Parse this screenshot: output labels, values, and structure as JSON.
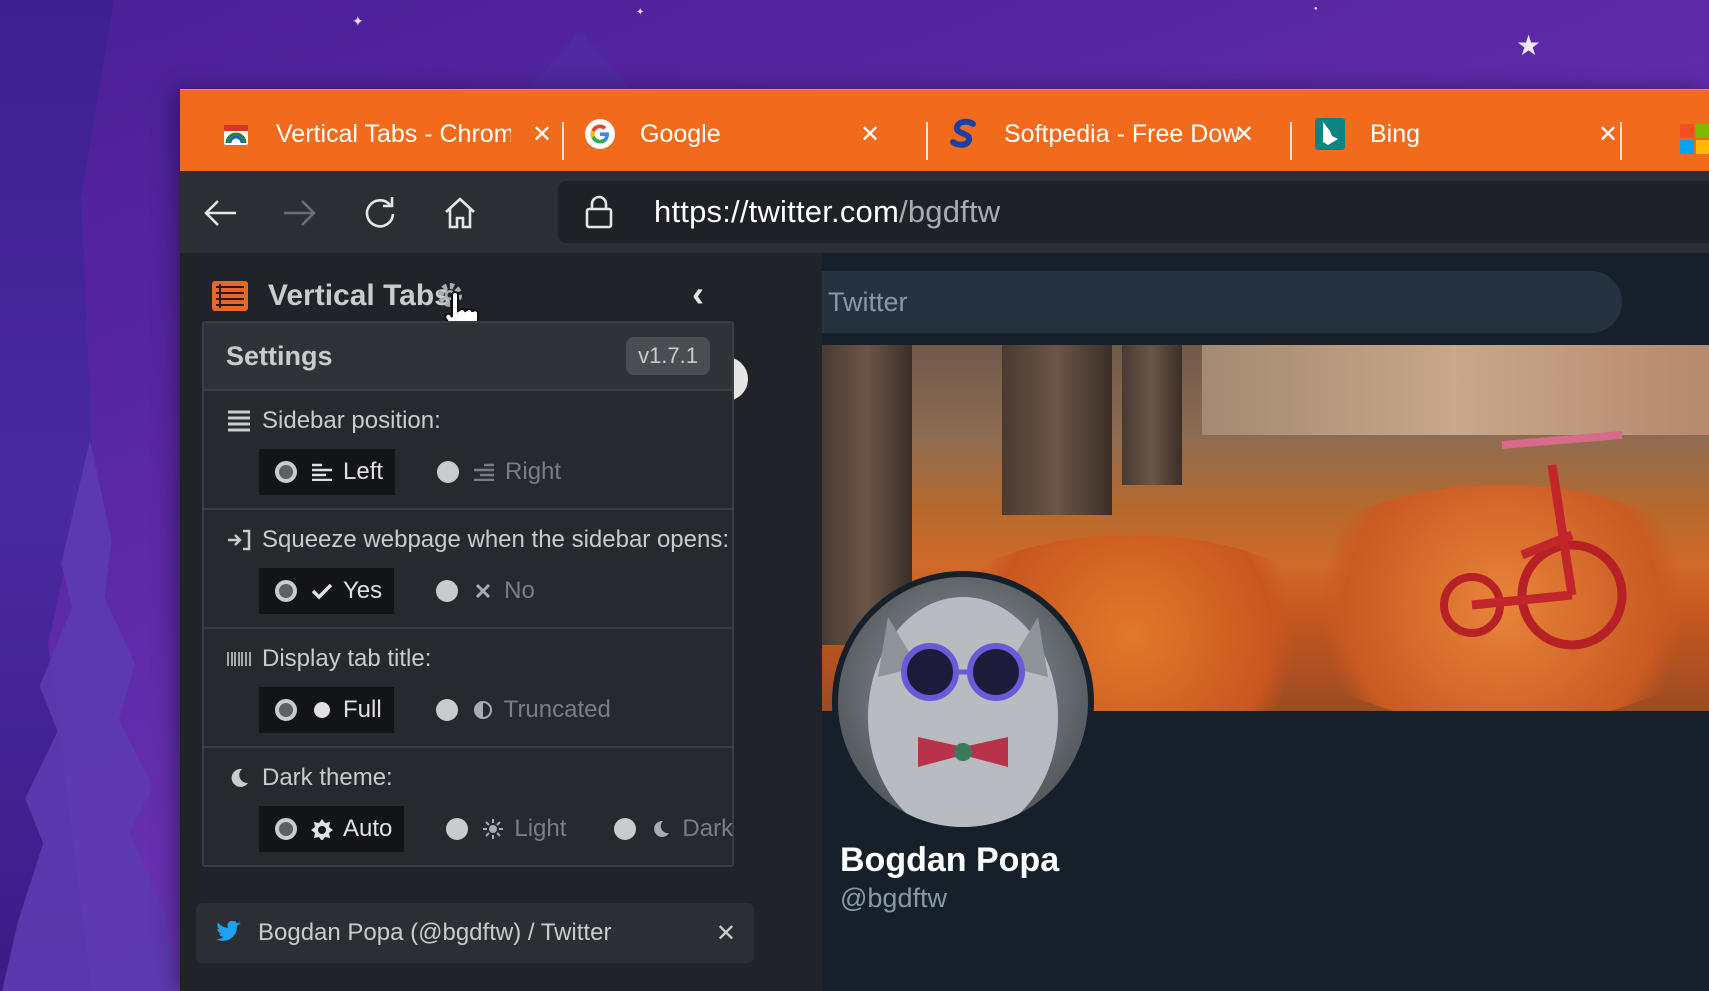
{
  "browser": {
    "tabs": [
      {
        "title": "Vertical Tabs - Chrome",
        "favicon": "vertical-tabs-favicon"
      },
      {
        "title": "Google",
        "favicon": "google-favicon"
      },
      {
        "title": "Softpedia - Free Down",
        "favicon": "softpedia-favicon"
      },
      {
        "title": "Bing",
        "favicon": "bing-favicon"
      }
    ],
    "close_glyph": "✕",
    "url_scheme": "https://",
    "url_host": "twitter.com",
    "url_path": "/bgdftw",
    "accent_color": "#f26b1d"
  },
  "sidebar": {
    "title": "Vertical Tabs",
    "collapse_glyph": "‹",
    "tab_item": "Bogdan Popa (@bgdftw) / Twitter",
    "tab_item_close": "✕"
  },
  "settings": {
    "title": "Settings",
    "version": "v1.7.1",
    "sections": [
      {
        "label": "Sidebar position:",
        "icon": "sidebar-icon",
        "options": [
          {
            "label": "Left",
            "selected": true
          },
          {
            "label": "Right",
            "selected": false
          }
        ]
      },
      {
        "label": "Squeeze webpage when the sidebar opens:",
        "icon": "squeeze-icon",
        "options": [
          {
            "label": "Yes",
            "selected": true
          },
          {
            "label": "No",
            "selected": false
          }
        ]
      },
      {
        "label": "Display tab title:",
        "icon": "barcode-icon",
        "options": [
          {
            "label": "Full",
            "selected": true
          },
          {
            "label": "Truncated",
            "selected": false
          }
        ]
      },
      {
        "label": "Dark theme:",
        "icon": "moon-icon",
        "options": [
          {
            "label": "Auto",
            "selected": true
          },
          {
            "label": "Light",
            "selected": false
          },
          {
            "label": "Dark",
            "selected": false
          }
        ]
      }
    ]
  },
  "page": {
    "search_placeholder": "Twitter",
    "profile_name": "Bogdan Popa",
    "profile_handle": "@bgdftw"
  }
}
